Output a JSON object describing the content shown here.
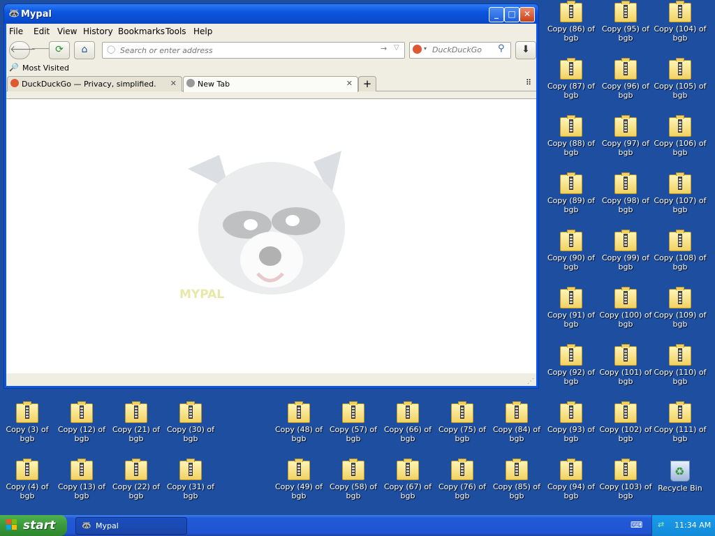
{
  "window": {
    "title": "Mypal",
    "minimize_label": "_",
    "maximize_label": "□",
    "close_label": "✕"
  },
  "menu": [
    "File",
    "Edit",
    "View",
    "History",
    "Bookmarks",
    "Tools",
    "Help"
  ],
  "toolbar": {
    "url_placeholder": "Search or enter address",
    "search_engine": "DuckDuckGo",
    "back_icon": "arrow-left-icon",
    "forward_icon": "arrow-right-icon",
    "reload_icon": "reload-icon",
    "home_icon": "home-icon"
  },
  "bookmarks": {
    "most_visited": "Most Visited"
  },
  "tabs": [
    {
      "title": "DuckDuckGo — Privacy, simplified.",
      "active": false
    },
    {
      "title": "New Tab",
      "active": true
    }
  ],
  "page": {
    "watermark_text": "MYPAL"
  },
  "desktop": {
    "right_icons": [
      [
        "Copy (86) of bgb",
        "Copy (95) of bgb",
        "Copy (104) of bgb"
      ],
      [
        "Copy (87) of bgb",
        "Copy (96) of bgb",
        "Copy (105) of bgb"
      ],
      [
        "Copy (88) of bgb",
        "Copy (97) of bgb",
        "Copy (106) of bgb"
      ],
      [
        "Copy (89) of bgb",
        "Copy (98) of bgb",
        "Copy (107) of bgb"
      ],
      [
        "Copy (90) of bgb",
        "Copy (99) of bgb",
        "Copy (108) of bgb"
      ],
      [
        "Copy (91) of bgb",
        "Copy (100) of bgb",
        "Copy (109) of bgb"
      ],
      [
        "Copy (92) of bgb",
        "Copy (101) of bgb",
        "Copy (110) of bgb"
      ]
    ],
    "bottom_row1": [
      "Copy (3) of bgb",
      "Copy (12) of bgb",
      "Copy (21) of bgb",
      "Copy (30) of bgb",
      "Copy (48) of bgb",
      "Copy (57) of bgb",
      "Copy (66) of bgb",
      "Copy (75) of bgb",
      "Copy (84) of bgb",
      "Copy (93) of bgb",
      "Copy (102) of bgb",
      "Copy (111) of bgb"
    ],
    "bottom_row2": [
      "Copy (4) of bgb",
      "Copy (13) of bgb",
      "Copy (22) of bgb",
      "Copy (31) of bgb",
      "Copy (49) of bgb",
      "Copy (58) of bgb",
      "Copy (67) of bgb",
      "Copy (76) of bgb",
      "Copy (85) of bgb",
      "Copy (94) of bgb",
      "Copy (103) of bgb",
      "Recycle Bin"
    ]
  },
  "taskbar": {
    "start_label": "start",
    "task_label": "Mypal",
    "clock": "11:34 AM"
  },
  "colors": {
    "desktop": "#1e4ea0",
    "taskbar": "#225ad8",
    "start": "#3a9a3a"
  }
}
